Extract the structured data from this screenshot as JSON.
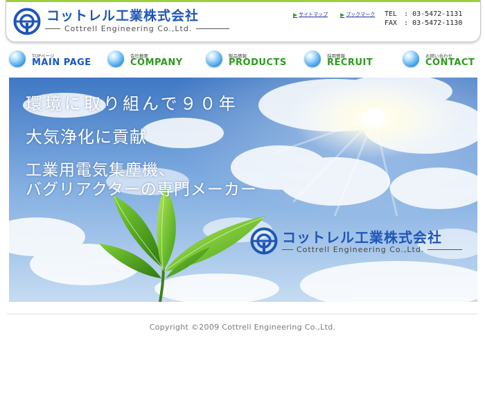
{
  "header": {
    "company_jp": "コットレル工業株式会社",
    "company_en": "Cottrell Engineering Co.,Ltd.",
    "logo_icon": "cottrell-logo-icon",
    "utility_links": [
      {
        "label": "サイトマップ"
      },
      {
        "label": "ブックマーク"
      }
    ],
    "tel_label": "TEL",
    "tel_value": ": 03-5472-1131",
    "fax_label": "FAX",
    "fax_value": ": 03-5472-1130",
    "accent_color": "#9ccf3c",
    "brand_color": "#1f55b7"
  },
  "nav": {
    "items": [
      {
        "sub": "TOPページ",
        "label": "MAIN PAGE",
        "color": "#1a56c8"
      },
      {
        "sub": "会社概要",
        "label": "COMPANY",
        "color": "#2c9a1e"
      },
      {
        "sub": "製品情報",
        "label": "PRODUCTS",
        "color": "#2c9a1e"
      },
      {
        "sub": "採用情報",
        "label": "RECRUIT",
        "color": "#2c9a1e"
      },
      {
        "sub": "お問い合わせ",
        "label": "CONTACT",
        "color": "#2c9a1e"
      }
    ]
  },
  "hero": {
    "line1": "環境に取り組んで９０年",
    "line2": "大気浄化に貢献",
    "line3": "工業用電気集塵機、",
    "line4": "バグリアクターの専門メーカー",
    "logo_jp": "コットレル工業株式会社",
    "logo_en": "Cottrell Engineering Co.,Ltd."
  },
  "footer": {
    "copyright": "Copyright ©2009 Cottrell Engineering Co.,Ltd."
  }
}
